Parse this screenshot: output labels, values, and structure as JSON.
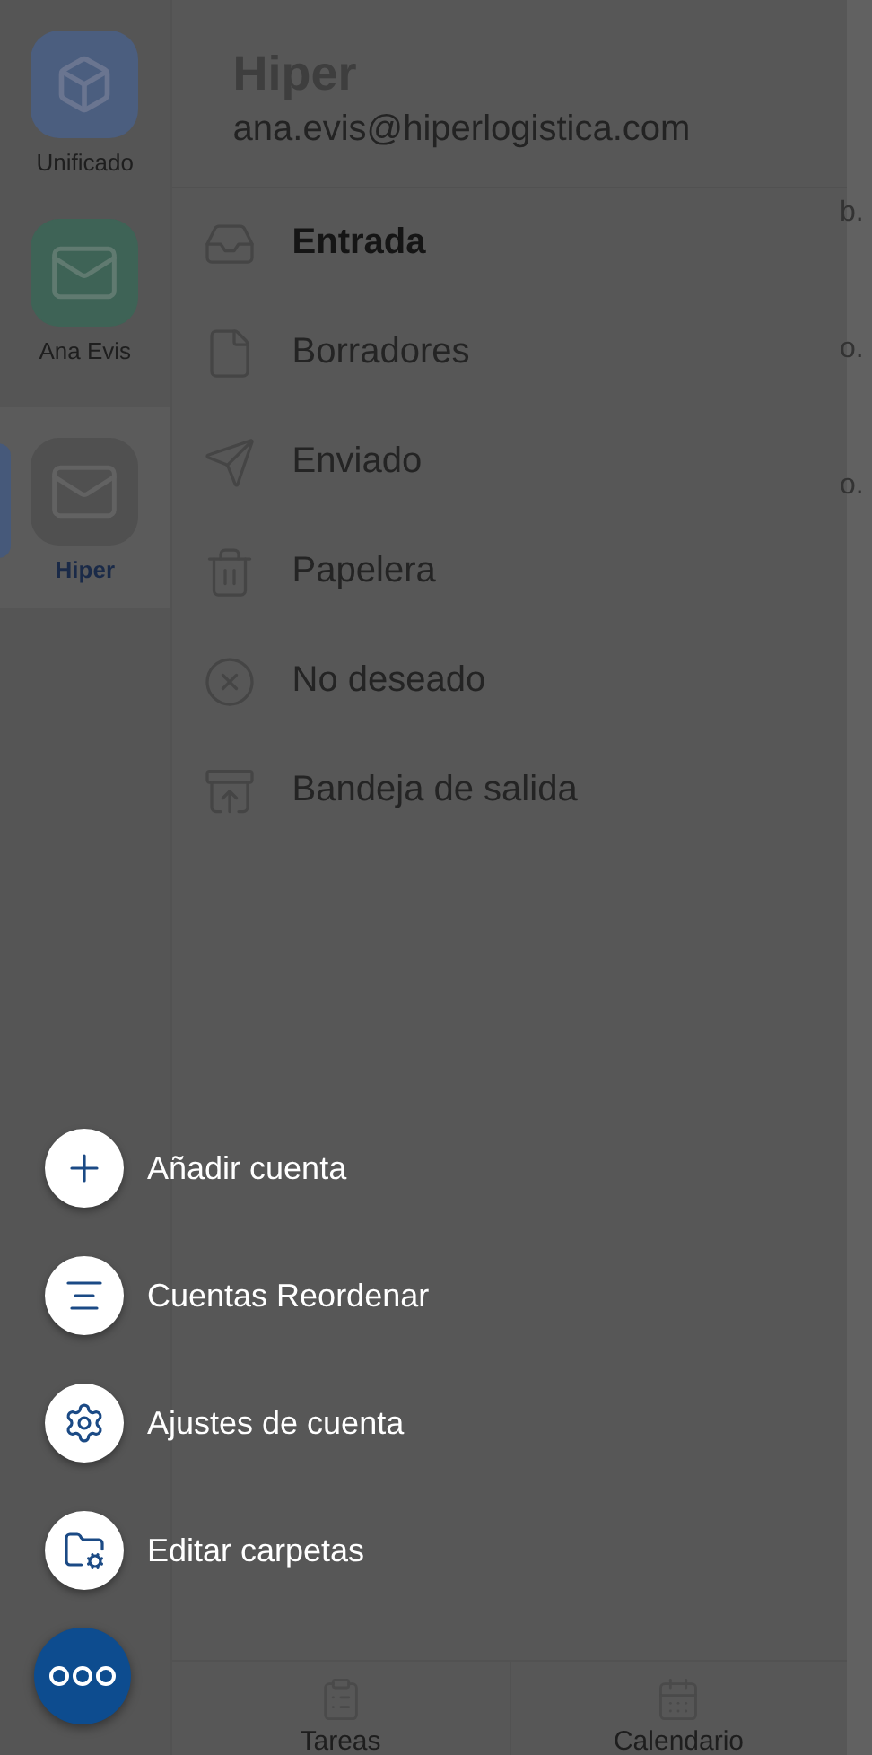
{
  "accounts": [
    {
      "label": "Unificado",
      "kind": "unified",
      "selected": false
    },
    {
      "label": "Ana Evis",
      "kind": "mail",
      "selected": false
    },
    {
      "label": "Hiper",
      "kind": "mail",
      "selected": true
    }
  ],
  "header": {
    "title": "Hiper",
    "email": "ana.evis@hiperlogistica.com"
  },
  "folders": [
    {
      "label": "Entrada",
      "kind": "inbox",
      "selected": true
    },
    {
      "label": "Borradores",
      "kind": "drafts",
      "selected": false
    },
    {
      "label": "Enviado",
      "kind": "sent",
      "selected": false
    },
    {
      "label": "Papelera",
      "kind": "trash",
      "selected": false
    },
    {
      "label": "No deseado",
      "kind": "junk",
      "selected": false
    },
    {
      "label": "Bandeja de salida",
      "kind": "outbox",
      "selected": false
    }
  ],
  "behind_list": [
    "b.",
    "o.",
    "o."
  ],
  "bottom_tabs": [
    {
      "label": "Tareas",
      "kind": "tasks"
    },
    {
      "label": "Calendario",
      "kind": "calendar"
    }
  ],
  "actions": [
    {
      "label": "Añadir cuenta",
      "kind": "add"
    },
    {
      "label": "Cuentas Reordenar",
      "kind": "reorder"
    },
    {
      "label": "Ajustes de cuenta",
      "kind": "settings"
    },
    {
      "label": "Editar carpetas",
      "kind": "folders"
    }
  ]
}
